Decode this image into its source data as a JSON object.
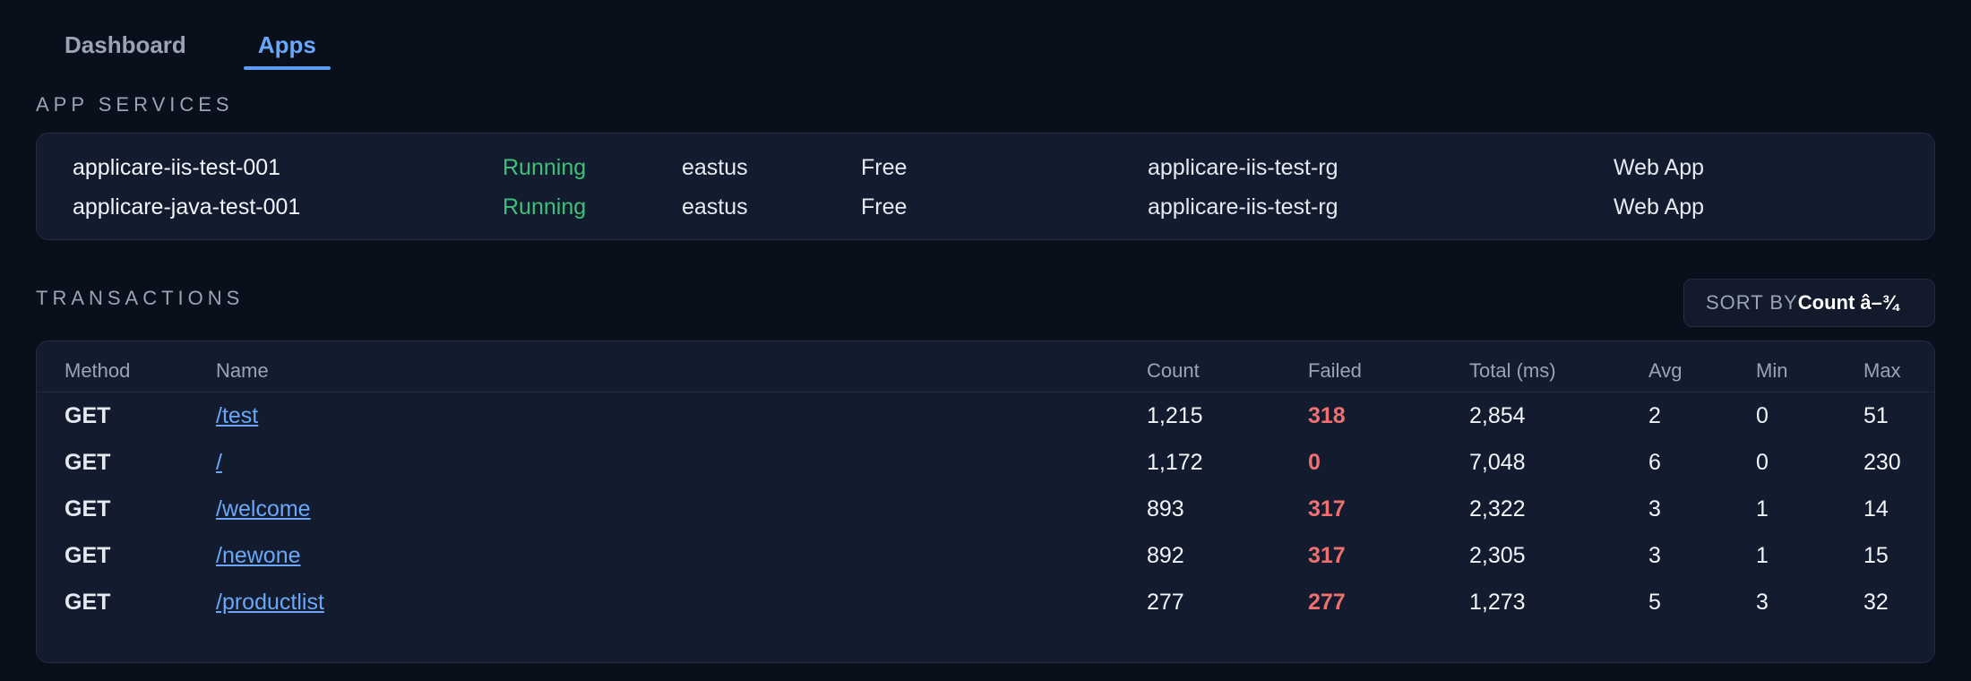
{
  "tabs": [
    {
      "label": "Dashboard",
      "active": false
    },
    {
      "label": "Apps",
      "active": true
    }
  ],
  "app_services": {
    "title": "APP SERVICES",
    "rows": [
      {
        "name": "applicare-iis-test-001",
        "status": "Running",
        "region": "eastus",
        "tier": "Free",
        "resource_group": "applicare-iis-test-rg",
        "kind": "Web App"
      },
      {
        "name": "applicare-java-test-001",
        "status": "Running",
        "region": "eastus",
        "tier": "Free",
        "resource_group": "applicare-iis-test-rg",
        "kind": "Web App"
      }
    ]
  },
  "transactions": {
    "title": "TRANSACTIONS",
    "sort": {
      "label": "SORT BY",
      "value": "Count â–¾"
    },
    "columns": {
      "method": "Method",
      "name": "Name",
      "count": "Count",
      "failed": "Failed",
      "total": "Total (ms)",
      "avg": "Avg",
      "min": "Min",
      "max": "Max"
    },
    "rows": [
      {
        "method": "GET",
        "name": "/test",
        "count": "1,215",
        "failed": "318",
        "total": "2,854",
        "avg": "2",
        "min": "0",
        "max": "51"
      },
      {
        "method": "GET",
        "name": "/",
        "count": "1,172",
        "failed": "0",
        "total": "7,048",
        "avg": "6",
        "min": "0",
        "max": "230"
      },
      {
        "method": "GET",
        "name": "/welcome",
        "count": "893",
        "failed": "317",
        "total": "2,322",
        "avg": "3",
        "min": "1",
        "max": "14"
      },
      {
        "method": "GET",
        "name": "/newone",
        "count": "892",
        "failed": "317",
        "total": "2,305",
        "avg": "3",
        "min": "1",
        "max": "15"
      },
      {
        "method": "GET",
        "name": "/productlist",
        "count": "277",
        "failed": "277",
        "total": "1,273",
        "avg": "5",
        "min": "3",
        "max": "32"
      }
    ]
  },
  "colors": {
    "background": "#0a0f1c",
    "panel": "#131c2e",
    "accent": "#6aa7f8",
    "running": "#3fc07a",
    "failed": "#f07070"
  }
}
